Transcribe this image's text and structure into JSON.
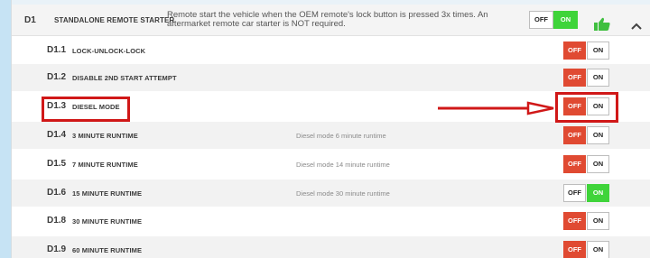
{
  "header": {
    "code": "D1",
    "name": "STANDALONE REMOTE STARTER",
    "description": "Remote start the vehicle when the OEM remote's lock button is pressed 3x times. An aftermarket remote car starter is NOT required.",
    "off_label": "OFF",
    "on_label": "ON",
    "state": "ON",
    "icons": [
      "thumbs-up-icon",
      "chevron-up-icon"
    ]
  },
  "rows": [
    {
      "code": "D1.1",
      "name": "LOCK-UNLOCK-LOCK",
      "note": "",
      "off_label": "OFF",
      "on_label": "ON",
      "state": "OFF"
    },
    {
      "code": "D1.2",
      "name": "DISABLE 2ND START ATTEMPT",
      "note": "",
      "off_label": "OFF",
      "on_label": "ON",
      "state": "OFF"
    },
    {
      "code": "D1.3",
      "name": "DIESEL MODE",
      "note": "",
      "off_label": "OFF",
      "on_label": "ON",
      "state": "OFF"
    },
    {
      "code": "D1.4",
      "name": "3 MINUTE RUNTIME",
      "note": "Diesel mode 6 minute runtime",
      "off_label": "OFF",
      "on_label": "ON",
      "state": "OFF"
    },
    {
      "code": "D1.5",
      "name": "7 MINUTE RUNTIME",
      "note": "Diesel mode 14 minute runtime",
      "off_label": "OFF",
      "on_label": "ON",
      "state": "OFF"
    },
    {
      "code": "D1.6",
      "name": "15 MINUTE RUNTIME",
      "note": "Diesel mode 30 minute runtime",
      "off_label": "OFF",
      "on_label": "ON",
      "state": "ON"
    },
    {
      "code": "D1.8",
      "name": "30 MINUTE RUNTIME",
      "note": "",
      "off_label": "OFF",
      "on_label": "ON",
      "state": "OFF"
    },
    {
      "code": "D1.9",
      "name": "60 MINUTE RUNTIME",
      "note": "",
      "off_label": "OFF",
      "on_label": "ON",
      "state": "OFF"
    }
  ],
  "colors": {
    "off_active": "#e04a32",
    "on_active": "#3fd43a",
    "highlight": "#d01818",
    "thumb": "#3fbf3f"
  }
}
